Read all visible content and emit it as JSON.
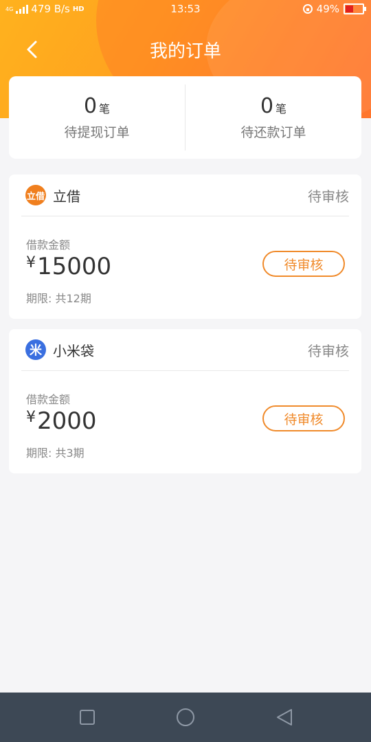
{
  "status_bar": {
    "network_badge": "4G",
    "speed": "479 B/s",
    "hd_badge": "HD",
    "time": "13:53",
    "battery_percent": "49%",
    "battery_level": 0.49
  },
  "nav": {
    "title": "我的订单"
  },
  "summary": {
    "pending_withdraw": {
      "count": "0",
      "unit": "笔",
      "label": "待提现订单"
    },
    "pending_repay": {
      "count": "0",
      "unit": "笔",
      "label": "待还款订单"
    }
  },
  "orders": [
    {
      "brand": "立借",
      "logo_text": "立借",
      "logo_color": "#f07f1e",
      "status": "待审核",
      "amount_label": "借款金额",
      "currency": "¥",
      "amount": "15000",
      "term": "期限: 共12期",
      "button_label": "待审核"
    },
    {
      "brand": "小米袋",
      "logo_text": "米",
      "logo_color": "#3a6fe0",
      "status": "待审核",
      "amount_label": "借款金额",
      "currency": "¥",
      "amount": "2000",
      "term": "期限: 共3期",
      "button_label": "待审核"
    }
  ],
  "colors": {
    "accent": "#f08a2a",
    "header_start": "#ffb21e",
    "header_end": "#ff7a30",
    "system_nav": "#3d4855"
  },
  "icons": {
    "back": "chevron-left-icon",
    "recent_apps": "square-icon",
    "home": "circle-icon",
    "system_back": "triangle-left-icon"
  }
}
